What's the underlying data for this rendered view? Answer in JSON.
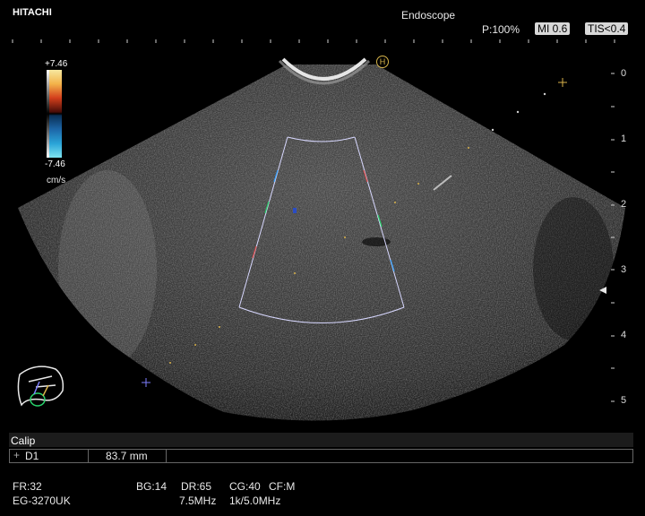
{
  "header": {
    "brand": "HITACHI",
    "mode": "Endoscope",
    "power": "P:100%",
    "mi": "MI 0.6",
    "tis": "TIS<0.4"
  },
  "color_scale": {
    "top": "+7.46",
    "bottom": "-7.46",
    "unit": "cm/s"
  },
  "depth_scale": [
    "0",
    "1",
    "2",
    "3",
    "4",
    "5"
  ],
  "measurement": {
    "title": "Calip",
    "label": "D1",
    "value": "83.7 mm"
  },
  "footer": {
    "fr": "FR:32",
    "probe": "EG-3270UK",
    "bg": "BG:14",
    "dr": "DR:65",
    "cg": "CG:40",
    "cf": "CF:M",
    "freq_b": "7.5MHz",
    "freq_c": "1k/5.0MHz"
  },
  "colors": {
    "marker": "#d9b24a",
    "roi": "#d8d8ff",
    "caliper": "#7f7fff"
  }
}
